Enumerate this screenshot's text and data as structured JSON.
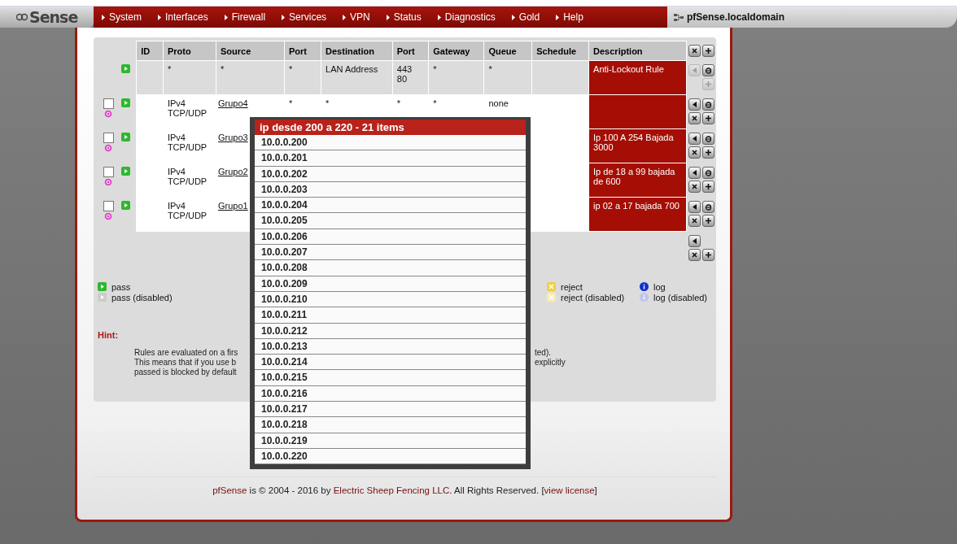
{
  "logo": {
    "text": "Sense"
  },
  "nav": [
    "System",
    "Interfaces",
    "Firewall",
    "Services",
    "VPN",
    "Status",
    "Diagnostics",
    "Gold",
    "Help"
  ],
  "hostname": "pfSense.localdomain",
  "table": {
    "columns": [
      "ID",
      "Proto",
      "Source",
      "Port",
      "Destination",
      "Port",
      "Gateway",
      "Queue",
      "Schedule",
      "Description"
    ],
    "rows": [
      {
        "kind": "locked",
        "cells": [
          "",
          "*",
          "*",
          "*",
          "LAN Address",
          "443\n80",
          "*",
          "*",
          "",
          ""
        ],
        "description": "Anti-Lockout Rule"
      },
      {
        "kind": "rule",
        "checked": false,
        "cells": [
          "",
          "IPv4\nTCP/UDP",
          "Grupo4",
          "*",
          "*",
          "*",
          "*",
          "none",
          "",
          ""
        ],
        "description": ""
      },
      {
        "kind": "rule",
        "checked": false,
        "cells": [
          "",
          "IPv4\nTCP/UDP",
          "Grupo3",
          "",
          "",
          "",
          "",
          "",
          "",
          ""
        ],
        "description": "Ip 100 A 254 Bajada 3000"
      },
      {
        "kind": "rule",
        "checked": false,
        "cells": [
          "",
          "IPv4\nTCP/UDP",
          "Grupo2",
          "",
          "",
          "",
          "",
          "",
          "",
          ""
        ],
        "description": "Ip de 18 a 99 bajada de 600"
      },
      {
        "kind": "rule",
        "checked": false,
        "cells": [
          "",
          "IPv4\nTCP/UDP",
          "Grupo1",
          "",
          "",
          "",
          "",
          "",
          "",
          ""
        ],
        "description": "ip 02 a 17 bajada 700"
      }
    ]
  },
  "legend": [
    {
      "kind": "pass",
      "label": "pass"
    },
    {
      "kind": "pass-disabled",
      "label": "pass (disabled)"
    },
    {
      "kind": "reject",
      "label": "reject"
    },
    {
      "kind": "reject-disabled",
      "label": "reject (disabled)"
    },
    {
      "kind": "log",
      "label": "log"
    },
    {
      "kind": "log-disabled",
      "label": "log (disabled)"
    }
  ],
  "hint": {
    "title": "Hint:",
    "lines": [
      {
        "left": "Rules are evaluated on a firs",
        "right": "ted)."
      },
      {
        "left": "This means that if you use b",
        "right": "explicitly"
      },
      {
        "left": "passed is blocked by default"
      }
    ]
  },
  "popup": {
    "title": "ip desde 200 a 220 - 21 items",
    "items": [
      "10.0.0.200",
      "10.0.0.201",
      "10.0.0.202",
      "10.0.0.203",
      "10.0.0.204",
      "10.0.0.205",
      "10.0.0.206",
      "10.0.0.207",
      "10.0.0.208",
      "10.0.0.209",
      "10.0.0.210",
      "10.0.0.211",
      "10.0.0.212",
      "10.0.0.213",
      "10.0.0.214",
      "10.0.0.215",
      "10.0.0.216",
      "10.0.0.217",
      "10.0.0.218",
      "10.0.0.219",
      "10.0.0.220"
    ]
  },
  "footer": [
    {
      "kind": "link",
      "text": "pfSense"
    },
    {
      "kind": "text",
      "text": " is © 2004 - 2016 by "
    },
    {
      "kind": "link",
      "text": "Electric Sheep Fencing LLC"
    },
    {
      "kind": "text",
      "text": ". All Rights Reserved. ["
    },
    {
      "kind": "link",
      "text": "view license"
    },
    {
      "kind": "text",
      "text": "]"
    }
  ]
}
